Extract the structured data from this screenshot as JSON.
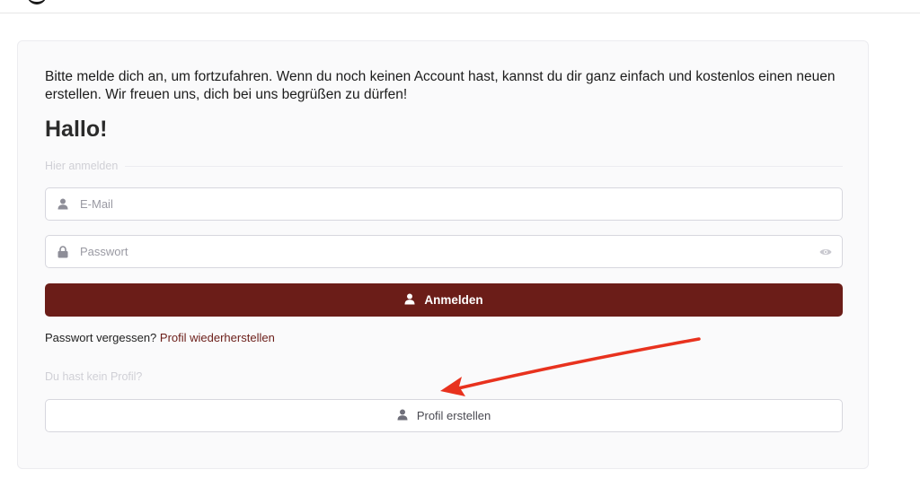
{
  "login_card": {
    "intro_text": "Bitte melde dich an, um fortzufahren. Wenn du noch keinen Account hast, kannst du dir ganz einfach und kostenlos einen neuen erstellen. Wir freuen uns, dich bei uns begrüßen zu dürfen!",
    "heading": "Hallo!",
    "login_section_label": "Hier anmelden",
    "email": {
      "placeholder": "E-Mail",
      "value": "",
      "icon": "user-icon"
    },
    "password": {
      "placeholder": "Passwort",
      "value": "",
      "icon": "lock-icon",
      "toggle_icon": "eye-icon"
    },
    "login_button": {
      "label": "Anmelden",
      "icon": "user-icon"
    },
    "forgot": {
      "text": "Passwort vergessen?",
      "link": "Profil wiederherstellen"
    },
    "register_section_label": "Du hast kein Profil?",
    "register_button": {
      "label": "Profil erstellen",
      "icon": "user-icon"
    }
  },
  "colors": {
    "primary": "#6b1d18",
    "annotation_arrow": "#e8321e",
    "card_background": "#fafafb",
    "muted_text": "#d0d0d6"
  }
}
